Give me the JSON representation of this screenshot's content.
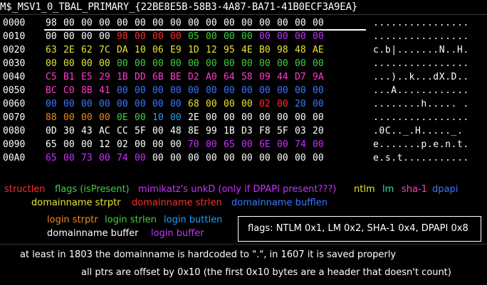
{
  "title": "M$_MSV1_0_TBAL_PRIMARY_{22BE8E5B-58B3-4A87-BA71-41B0ECF3A9EA}",
  "colors": {
    "white": "#ffffff",
    "red": "#ff2d2d",
    "green": "#3cd23c",
    "yellow": "#e6e632",
    "orange": "#f08a1e",
    "pink": "#ff3cc8",
    "magenta": "#c832ff",
    "blue": "#3a78ff",
    "cyan": "#1ea0ff",
    "teal": "#28e0b4",
    "brown": "#c88232"
  },
  "hex_rows": [
    {
      "offset": "0000",
      "ascii": "................",
      "bytes": [
        [
          "98",
          "white"
        ],
        [
          "00",
          "white"
        ],
        [
          "00",
          "white"
        ],
        [
          "00",
          "white"
        ],
        [
          "00",
          "white"
        ],
        [
          "00",
          "white"
        ],
        [
          "00",
          "white"
        ],
        [
          "00",
          "white"
        ],
        [
          "00",
          "white"
        ],
        [
          "00",
          "white"
        ],
        [
          "00",
          "white"
        ],
        [
          "00",
          "white"
        ],
        [
          "00",
          "white"
        ],
        [
          "00",
          "white"
        ],
        [
          "00",
          "white"
        ],
        [
          "00",
          "white"
        ]
      ]
    },
    {
      "offset": "0010",
      "ascii": "................",
      "bytes": [
        [
          "00",
          "white"
        ],
        [
          "00",
          "white"
        ],
        [
          "00",
          "white"
        ],
        [
          "00",
          "white"
        ],
        [
          "98",
          "red"
        ],
        [
          "00",
          "red"
        ],
        [
          "00",
          "red"
        ],
        [
          "00",
          "red"
        ],
        [
          "05",
          "green"
        ],
        [
          "00",
          "green"
        ],
        [
          "00",
          "green"
        ],
        [
          "00",
          "green"
        ],
        [
          "00",
          "magenta"
        ],
        [
          "00",
          "magenta"
        ],
        [
          "00",
          "magenta"
        ],
        [
          "00",
          "magenta"
        ]
      ]
    },
    {
      "offset": "0020",
      "ascii": "c.b|.......N..H.",
      "bytes": [
        [
          "63",
          "yellow"
        ],
        [
          "2E",
          "yellow"
        ],
        [
          "62",
          "yellow"
        ],
        [
          "7C",
          "yellow"
        ],
        [
          "DA",
          "yellow"
        ],
        [
          "10",
          "yellow"
        ],
        [
          "06",
          "yellow"
        ],
        [
          "E9",
          "yellow"
        ],
        [
          "1D",
          "yellow"
        ],
        [
          "12",
          "yellow"
        ],
        [
          "95",
          "yellow"
        ],
        [
          "4E",
          "yellow"
        ],
        [
          "B0",
          "yellow"
        ],
        [
          "98",
          "yellow"
        ],
        [
          "48",
          "yellow"
        ],
        [
          "AE",
          "yellow"
        ]
      ]
    },
    {
      "offset": "0030",
      "ascii": "................",
      "bytes": [
        [
          "00",
          "yellow"
        ],
        [
          "00",
          "yellow"
        ],
        [
          "00",
          "yellow"
        ],
        [
          "00",
          "yellow"
        ],
        [
          "00",
          "green"
        ],
        [
          "00",
          "green"
        ],
        [
          "00",
          "green"
        ],
        [
          "00",
          "green"
        ],
        [
          "00",
          "green"
        ],
        [
          "00",
          "green"
        ],
        [
          "00",
          "green"
        ],
        [
          "00",
          "green"
        ],
        [
          "00",
          "green"
        ],
        [
          "00",
          "green"
        ],
        [
          "00",
          "green"
        ],
        [
          "00",
          "green"
        ]
      ]
    },
    {
      "offset": "0040",
      "ascii": "...)..k...dX.D..",
      "bytes": [
        [
          "C5",
          "pink"
        ],
        [
          "B1",
          "pink"
        ],
        [
          "E5",
          "pink"
        ],
        [
          "29",
          "pink"
        ],
        [
          "1B",
          "pink"
        ],
        [
          "DD",
          "pink"
        ],
        [
          "6B",
          "pink"
        ],
        [
          "BE",
          "pink"
        ],
        [
          "D2",
          "pink"
        ],
        [
          "A0",
          "pink"
        ],
        [
          "64",
          "pink"
        ],
        [
          "58",
          "pink"
        ],
        [
          "09",
          "pink"
        ],
        [
          "44",
          "pink"
        ],
        [
          "D7",
          "pink"
        ],
        [
          "9A",
          "pink"
        ]
      ]
    },
    {
      "offset": "0050",
      "ascii": "...A............",
      "bytes": [
        [
          "BC",
          "pink"
        ],
        [
          "C0",
          "pink"
        ],
        [
          "8B",
          "pink"
        ],
        [
          "41",
          "pink"
        ],
        [
          "00",
          "blue"
        ],
        [
          "00",
          "blue"
        ],
        [
          "00",
          "blue"
        ],
        [
          "00",
          "blue"
        ],
        [
          "00",
          "blue"
        ],
        [
          "00",
          "blue"
        ],
        [
          "00",
          "blue"
        ],
        [
          "00",
          "blue"
        ],
        [
          "00",
          "blue"
        ],
        [
          "00",
          "blue"
        ],
        [
          "00",
          "blue"
        ],
        [
          "00",
          "blue"
        ]
      ]
    },
    {
      "offset": "0060",
      "ascii": "........h..... .",
      "bytes": [
        [
          "00",
          "blue"
        ],
        [
          "00",
          "blue"
        ],
        [
          "00",
          "blue"
        ],
        [
          "00",
          "blue"
        ],
        [
          "00",
          "blue"
        ],
        [
          "00",
          "blue"
        ],
        [
          "00",
          "blue"
        ],
        [
          "00",
          "blue"
        ],
        [
          "68",
          "yellow"
        ],
        [
          "00",
          "yellow"
        ],
        [
          "00",
          "yellow"
        ],
        [
          "00",
          "yellow"
        ],
        [
          "02",
          "red"
        ],
        [
          "00",
          "red"
        ],
        [
          "20",
          "blue"
        ],
        [
          "00",
          "blue"
        ]
      ]
    },
    {
      "offset": "0070",
      "ascii": "................",
      "bytes": [
        [
          "88",
          "orange"
        ],
        [
          "00",
          "orange"
        ],
        [
          "00",
          "orange"
        ],
        [
          "00",
          "orange"
        ],
        [
          "0E",
          "green"
        ],
        [
          "00",
          "green"
        ],
        [
          "10",
          "cyan"
        ],
        [
          "00",
          "cyan"
        ],
        [
          "2E",
          "white"
        ],
        [
          "00",
          "white"
        ],
        [
          "00",
          "white"
        ],
        [
          "00",
          "white"
        ],
        [
          "00",
          "white"
        ],
        [
          "00",
          "white"
        ],
        [
          "00",
          "white"
        ],
        [
          "00",
          "white"
        ]
      ]
    },
    {
      "offset": "0080",
      "ascii": ".0C.._.H....._.",
      "bytes": [
        [
          "0D",
          "white"
        ],
        [
          "30",
          "white"
        ],
        [
          "43",
          "white"
        ],
        [
          "AC",
          "white"
        ],
        [
          "CC",
          "white"
        ],
        [
          "5F",
          "white"
        ],
        [
          "00",
          "white"
        ],
        [
          "48",
          "white"
        ],
        [
          "8E",
          "white"
        ],
        [
          "99",
          "white"
        ],
        [
          "1B",
          "white"
        ],
        [
          "D3",
          "white"
        ],
        [
          "F8",
          "white"
        ],
        [
          "5F",
          "white"
        ],
        [
          "03",
          "white"
        ],
        [
          "20",
          "white"
        ]
      ]
    },
    {
      "offset": "0090",
      "ascii": "e.......p.e.n.t.",
      "bytes": [
        [
          "65",
          "white"
        ],
        [
          "00",
          "white"
        ],
        [
          "00",
          "white"
        ],
        [
          "12",
          "white"
        ],
        [
          "02",
          "white"
        ],
        [
          "00",
          "white"
        ],
        [
          "00",
          "white"
        ],
        [
          "00",
          "white"
        ],
        [
          "70",
          "magenta"
        ],
        [
          "00",
          "magenta"
        ],
        [
          "65",
          "magenta"
        ],
        [
          "00",
          "magenta"
        ],
        [
          "6E",
          "magenta"
        ],
        [
          "00",
          "magenta"
        ],
        [
          "74",
          "magenta"
        ],
        [
          "00",
          "magenta"
        ]
      ]
    },
    {
      "offset": "00A0",
      "ascii": "e.s.t...........",
      "bytes": [
        [
          "65",
          "magenta"
        ],
        [
          "00",
          "magenta"
        ],
        [
          "73",
          "magenta"
        ],
        [
          "00",
          "magenta"
        ],
        [
          "74",
          "magenta"
        ],
        [
          "00",
          "magenta"
        ],
        [
          "00",
          "white"
        ],
        [
          "00",
          "white"
        ],
        [
          "00",
          "white"
        ],
        [
          "00",
          "white"
        ],
        [
          "00",
          "white"
        ],
        [
          "00",
          "white"
        ],
        [
          "00",
          "white"
        ],
        [
          "00",
          "white"
        ],
        [
          "00",
          "white"
        ],
        [
          "00",
          "white"
        ]
      ]
    }
  ],
  "legend": {
    "structlen": "structlen",
    "flags": "flags (isPresent)",
    "unk": "mimikatz's unkD (only if DPAPI present???)",
    "ntlm": "ntlm",
    "lm": "lm",
    "sha1": "sha-1",
    "dpapi": "dpapi",
    "dom_strptr": "domainname strptr",
    "dom_strlen": "domainname strlen",
    "dom_bufflen": "domainname bufflen",
    "login_strptr": "login strptr",
    "login_strlen": "login strlen",
    "login_buttlen": "login buttlen",
    "dom_buffer": "domainname buffer",
    "login_buffer": "login buffer"
  },
  "flags_box": "flags: NTLM 0x1, LM 0x2, SHA-1 0x4, DPAPI 0x8",
  "notes": {
    "line1": "at least in 1803 the domainname is hardcoded to \".\", in 1607 it is saved properly",
    "line2": "all ptrs are offset by 0x10 (the first 0x10 bytes are a header that doesn't count)"
  }
}
